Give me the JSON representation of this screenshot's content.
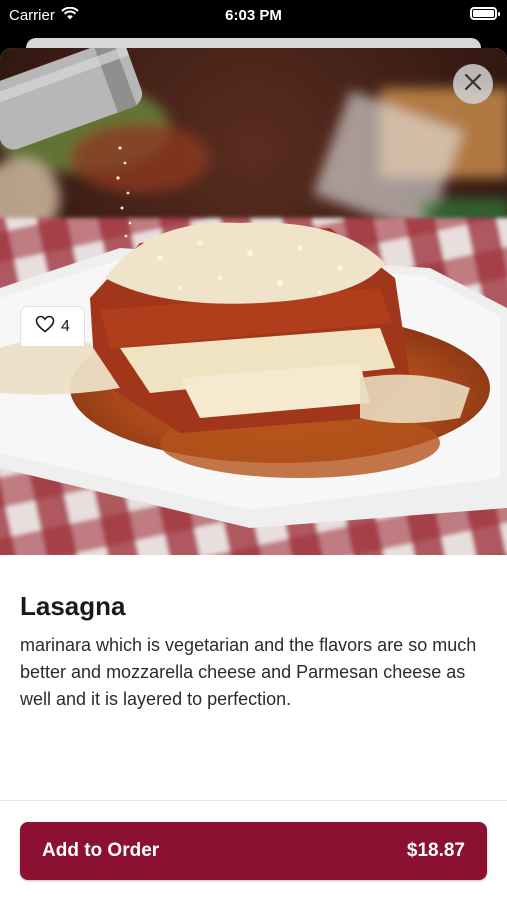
{
  "status_bar": {
    "carrier": "Carrier",
    "time": "6:03 PM"
  },
  "item": {
    "name": "Lasagna",
    "description": "marinara which is vegetarian and the flavors are so much better and mozzarella cheese and Parmesan cheese as well and it is layered to perfection.",
    "likes": "4",
    "image_alt": "Lasagna topped with grated parmesan on a white plate"
  },
  "footer": {
    "add_label": "Add to Order",
    "price": "$18.87"
  },
  "colors": {
    "accent": "#8b1032",
    "background": "#ffffff",
    "text": "#1a1a1a"
  },
  "icons": {
    "wifi": "wifi-icon",
    "battery": "battery-icon",
    "close": "close-icon",
    "like": "heart-icon"
  }
}
